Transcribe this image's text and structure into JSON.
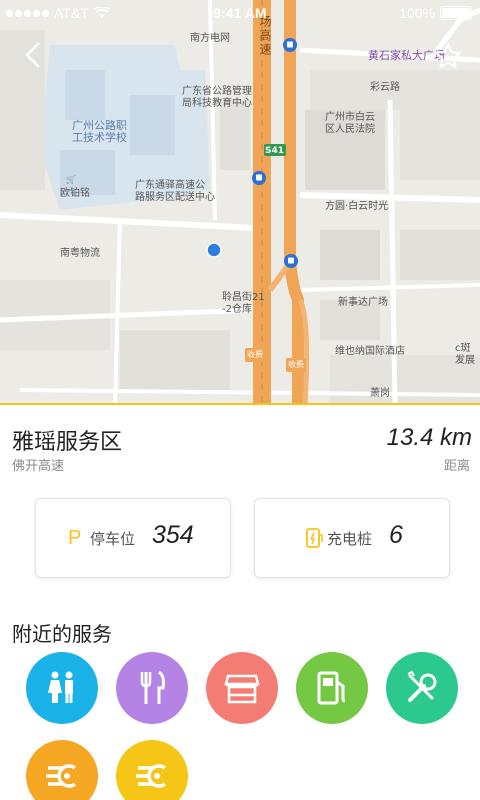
{
  "status_bar": {
    "carrier": "AT&T",
    "time": "9:41 AM",
    "battery": "100%"
  },
  "map": {
    "road_name": "场高速",
    "road_shield": "S41",
    "labels": {
      "nanfang": "南方电网",
      "school": "广州公路职\n工技术学校",
      "gd_bureau": "广东省公路管理\n局科技教育中心",
      "ouding": "欧铂铭",
      "tongyi": "广东通驿高速公\n路服务区配送中心",
      "nanyue": "南粤物流",
      "jinchang": "聆昌街21\n-2仓库",
      "huangshi": "黄石家私大广场",
      "caiyun": "彩云路",
      "court": "广州市白云\n区人民法院",
      "fangyuan": "方圆·白云时光",
      "xinshida": "新事达广场",
      "weiyena": "维也纳国际酒店",
      "fa": "c斑\n发展",
      "toll1": "收费",
      "toll2": "收费",
      "xiao": "萧岗"
    }
  },
  "station": {
    "name": "雅瑶服务区",
    "highway": "佛开高速",
    "distance": "13.4 km",
    "distance_label": "距离"
  },
  "cards": {
    "parking": {
      "icon": "P",
      "label": "停车位",
      "value": "354"
    },
    "charging": {
      "label": "充电桩",
      "value": "6"
    }
  },
  "services": {
    "title": "附近的服务",
    "items": [
      {
        "name": "restroom",
        "color": "#1ab2e8"
      },
      {
        "name": "restaurant",
        "color": "#b583e6"
      },
      {
        "name": "shop",
        "color": "#f47d73"
      },
      {
        "name": "gas-station",
        "color": "#74c844"
      },
      {
        "name": "repair",
        "color": "#2cc98e"
      },
      {
        "name": "ev-charging",
        "color": "#f5a623"
      },
      {
        "name": "ev-charging",
        "color": "#f5c518"
      }
    ]
  },
  "colors": {
    "accent": "#f5c518",
    "location_dot": "#2e7de0"
  }
}
